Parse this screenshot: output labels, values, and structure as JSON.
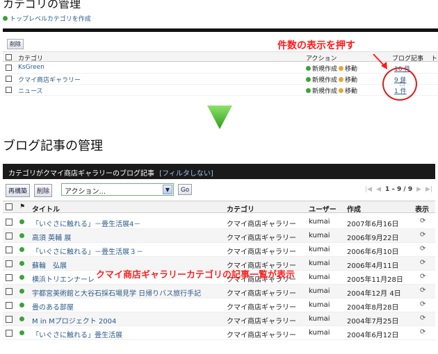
{
  "top": {
    "title": "カテゴリの管理",
    "create_link": "トップレベルカテゴリを作成",
    "delete_button": "削除",
    "headers": {
      "category": "カテゴリ",
      "action": "アクション",
      "count": "ブログ記事",
      "t": "ト"
    },
    "rows": [
      {
        "name": "KsGreen",
        "new": "新規作成",
        "move": "移動",
        "count": "16 件"
      },
      {
        "name": "クマイ商店ギャラリー",
        "new": "新規作成",
        "move": "移動",
        "count": "9 件"
      },
      {
        "name": "ニュース",
        "new": "新規作成",
        "move": "移動",
        "count": "1 件"
      }
    ]
  },
  "annotations": {
    "click_count": "件数の表示を押す",
    "result": "クマイ商店ギャラリーカテゴリの記事一覧が表示"
  },
  "bottom": {
    "title": "ブログ記事の管理",
    "bar_title": "カテゴリがクマイ商店ギャラリーのブログ記事",
    "bar_filter": "[フィルタしない]",
    "rebuild_button": "再構築",
    "delete_button": "削除",
    "action_select": "アクション...",
    "go_button": "Go",
    "pager_range": "1 – 9 / 9",
    "headers": {
      "title": "タイトル",
      "category": "カテゴリ",
      "user": "ユーザー",
      "created": "作成",
      "view": "表示"
    },
    "rows": [
      {
        "title": "「いぐさに触れる」－畳生活展4－",
        "category": "クマイ商店ギャラリー",
        "user": "kumai",
        "date": "2007年6月16日"
      },
      {
        "title": "高須 英輔 展",
        "category": "クマイ商店ギャラリー",
        "user": "kumai",
        "date": "2006年9月22日"
      },
      {
        "title": "「いぐさに触れる」－畳生活展３－",
        "category": "クマイ商店ギャラリー",
        "user": "kumai",
        "date": "2006年6月10日"
      },
      {
        "title": "蘇輪　弘展",
        "category": "クマイ商店ギャラリー",
        "user": "kumai",
        "date": "2006年4月11日"
      },
      {
        "title": "横浜トリエンナーレ",
        "category": "クマイ商店ギャラリー",
        "user": "kumai",
        "date": "2005年11月28日"
      },
      {
        "title": "宇都宮美術館と大谷石採石場見学 日帰りバス旅行手記",
        "category": "クマイ商店ギャラリー",
        "user": "kumai",
        "date": "2004年12月 4日"
      },
      {
        "title": "畳のある部屋",
        "category": "クマイ商店ギャラリー",
        "user": "kumai",
        "date": "2004年8月28日"
      },
      {
        "title": "M in Mプロジェクト 2004",
        "category": "クマイ商店ギャラリー",
        "user": "kumai",
        "date": "2004年7月25日"
      },
      {
        "title": "「いぐさに触れる」畳生活展",
        "category": "クマイ商店ギャラリー",
        "user": "kumai",
        "date": "2004年6月12日"
      }
    ]
  },
  "colors": {
    "link": "#2b5a8a",
    "annotation": "#ff1a1a",
    "arrow": "#4cc02a"
  }
}
